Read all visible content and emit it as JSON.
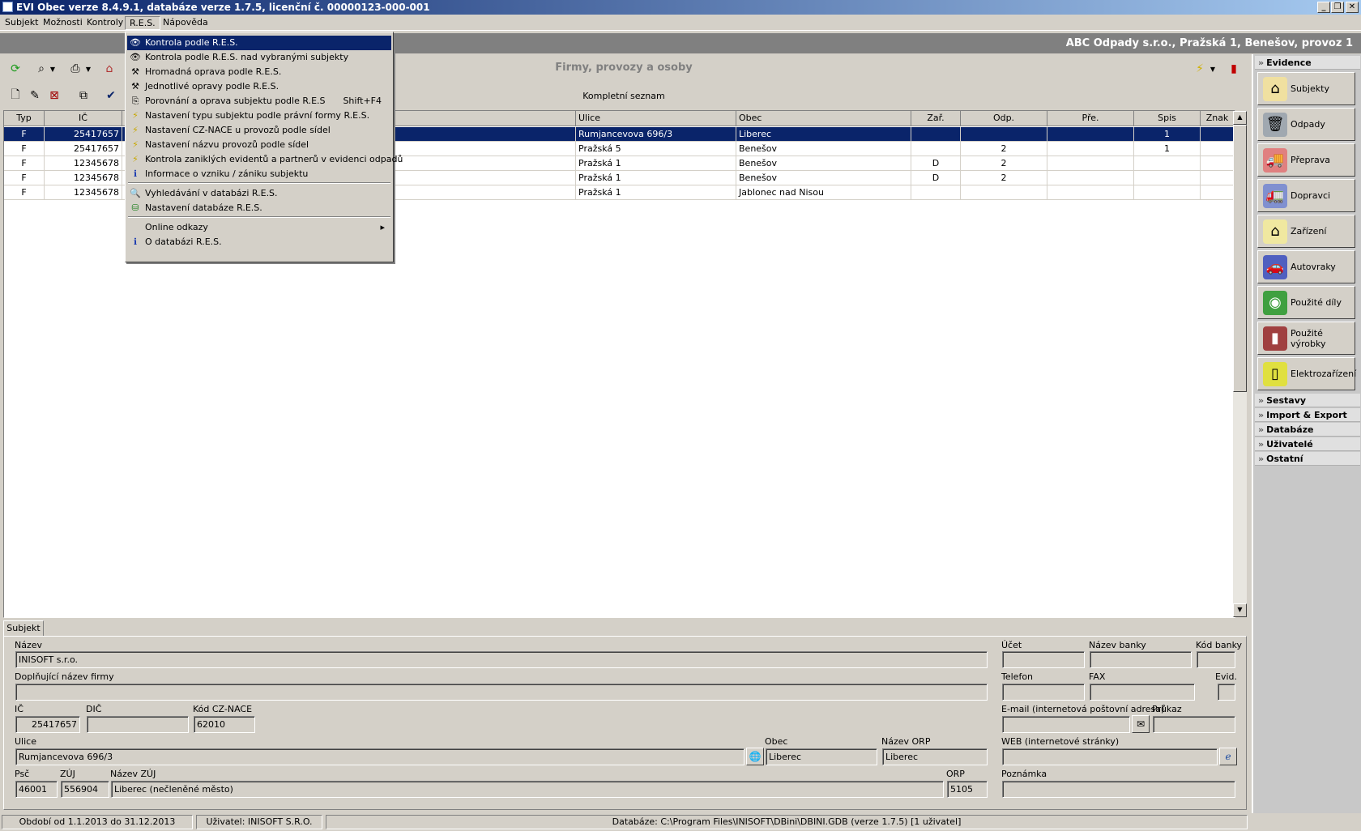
{
  "window": {
    "title": "EVI Obec verze 8.4.9.1, databáze verze 1.7.5, licenční č. 00000123-000-001",
    "controls": [
      "_",
      "❐",
      "✕"
    ]
  },
  "menubar": {
    "items": [
      "Subjekt",
      "Možnosti",
      "Kontroly",
      "R.E.S.",
      "Nápověda"
    ]
  },
  "company_bar": "ABC Odpady s.r.o., Pražská 1, Benešov, provoz 1",
  "header": {
    "title": "Firmy, provozy a osoby",
    "subtitle": "Kompletní seznam"
  },
  "grid": {
    "columns": [
      "Typ",
      "IČ",
      "",
      "Ulice",
      "Obec",
      "Zař.",
      "Odp.",
      "Pře.",
      "Spis",
      "Znak"
    ],
    "rows": [
      {
        "typ": "F",
        "ic": "25417657",
        "name": "",
        "ulice": "Rumjancevova 696/3",
        "obec": "Liberec",
        "zar": "",
        "odp": "",
        "pre": "",
        "spis": "1",
        "znak": ""
      },
      {
        "typ": "F",
        "ic": "25417657",
        "name": "",
        "ulice": "Pražská 5",
        "obec": "Benešov",
        "zar": "",
        "odp": "2",
        "pre": "",
        "spis": "1",
        "znak": ""
      },
      {
        "typ": "F",
        "ic": "12345678",
        "name": "",
        "ulice": "Pražská 1",
        "obec": "Benešov",
        "zar": "D",
        "odp": "2",
        "pre": "",
        "spis": "",
        "znak": ""
      },
      {
        "typ": "F",
        "ic": "12345678",
        "name": "",
        "ulice": "Pražská 1",
        "obec": "Benešov",
        "zar": "D",
        "odp": "2",
        "pre": "",
        "spis": "",
        "znak": ""
      },
      {
        "typ": "F",
        "ic": "12345678",
        "name": "",
        "ulice": "Pražská 1",
        "obec": "Jablonec nad Nisou",
        "zar": "",
        "odp": "",
        "pre": "",
        "spis": "",
        "znak": ""
      }
    ]
  },
  "res_menu": {
    "items": [
      {
        "label": "Kontrola podle R.E.S.",
        "shortcut": "",
        "icon": "eye-icon"
      },
      {
        "label": "Kontrola podle R.E.S. nad vybranými subjekty",
        "shortcut": "",
        "icon": "eye-icon"
      },
      {
        "label": "Hromadná oprava podle R.E.S.",
        "shortcut": "",
        "icon": "tools-icon"
      },
      {
        "label": "Jednotlivé opravy podle R.E.S.",
        "shortcut": "",
        "icon": "tools-icon"
      },
      {
        "label": "Porovnání a oprava subjektu podle R.E.S",
        "shortcut": "Shift+F4",
        "icon": "compare-icon"
      },
      {
        "label": "Nastavení typu subjektu podle právní formy R.E.S.",
        "shortcut": "",
        "icon": "lightning-icon"
      },
      {
        "label": "Nastavení CZ-NACE u provozů podle sídel",
        "shortcut": "",
        "icon": "lightning-icon"
      },
      {
        "label": "Nastavení názvu provozů podle sídel",
        "shortcut": "",
        "icon": "lightning-icon"
      },
      {
        "label": "Kontrola zaniklých evidentů a partnerů v evidenci odpadů",
        "shortcut": "",
        "icon": "lightning-icon"
      },
      {
        "label": "Informace o vzniku / zániku subjektu",
        "shortcut": "",
        "icon": "info-icon"
      },
      {
        "label": "Vyhledávání v databázi R.E.S.",
        "shortcut": "",
        "icon": "search-doc-icon"
      },
      {
        "label": "Nastavení databáze R.E.S.",
        "shortcut": "",
        "icon": "db-icon"
      },
      {
        "label": "Online odkazy",
        "shortcut": "",
        "icon": ""
      },
      {
        "label": "O databázi R.E.S.",
        "shortcut": "",
        "icon": "info-icon"
      }
    ]
  },
  "detail": {
    "tab": "Subjekt",
    "labels": {
      "nazev": "Název",
      "dopl": "Doplňující název firmy",
      "ic": "IČ",
      "dic": "DIČ",
      "nace": "Kód CZ-NACE",
      "ulice": "Ulice",
      "obec": "Obec",
      "orp_name": "Název ORP",
      "psc": "Psč",
      "zuj": "ZÚJ",
      "zuj_name": "Název ZÚJ",
      "orp": "ORP",
      "ucet": "Účet",
      "banka": "Název banky",
      "kod_banky": "Kód banky",
      "telefon": "Telefon",
      "fax": "FAX",
      "evid": "Evid.",
      "email": "E-mail (internetová poštovní adresa)",
      "prukaz": "Průkaz",
      "web": "WEB (internetové stránky)",
      "poznamka": "Poznámka"
    },
    "values": {
      "nazev": "INISOFT s.r.o.",
      "dopl": "",
      "ic": "25417657",
      "dic": "",
      "nace": "62010",
      "ulice": "Rumjancevova 696/3",
      "obec": "Liberec",
      "orp_name": "Liberec",
      "psc": "46001",
      "zuj": "556904",
      "zuj_name": "Liberec (nečleněné město)",
      "orp": "5105",
      "ucet": "",
      "banka": "",
      "kod_banky": "",
      "telefon": "",
      "fax": "",
      "evid": "",
      "email": "",
      "prukaz": "",
      "web": "",
      "poznamka": ""
    }
  },
  "right_panel": {
    "evidence": "Evidence",
    "buttons": [
      "Subjekty",
      "Odpady",
      "Přeprava",
      "Dopravci",
      "Zařízení",
      "Autovraky",
      "Použité díly",
      "Použité výrobky",
      "Elektrozařízení"
    ],
    "sections": [
      "Sestavy",
      "Import & Export",
      "Databáze",
      "Uživatelé",
      "Ostatní"
    ]
  },
  "statusbar": {
    "period": "Období od 1.1.2013 do 31.12.2013",
    "user": "Uživatel: INISOFT S.R.O.",
    "database": "Databáze: C:\\Program Files\\INISOFT\\DBini\\DBINI.GDB  (verze 1.7.5) [1 uživatel]"
  }
}
